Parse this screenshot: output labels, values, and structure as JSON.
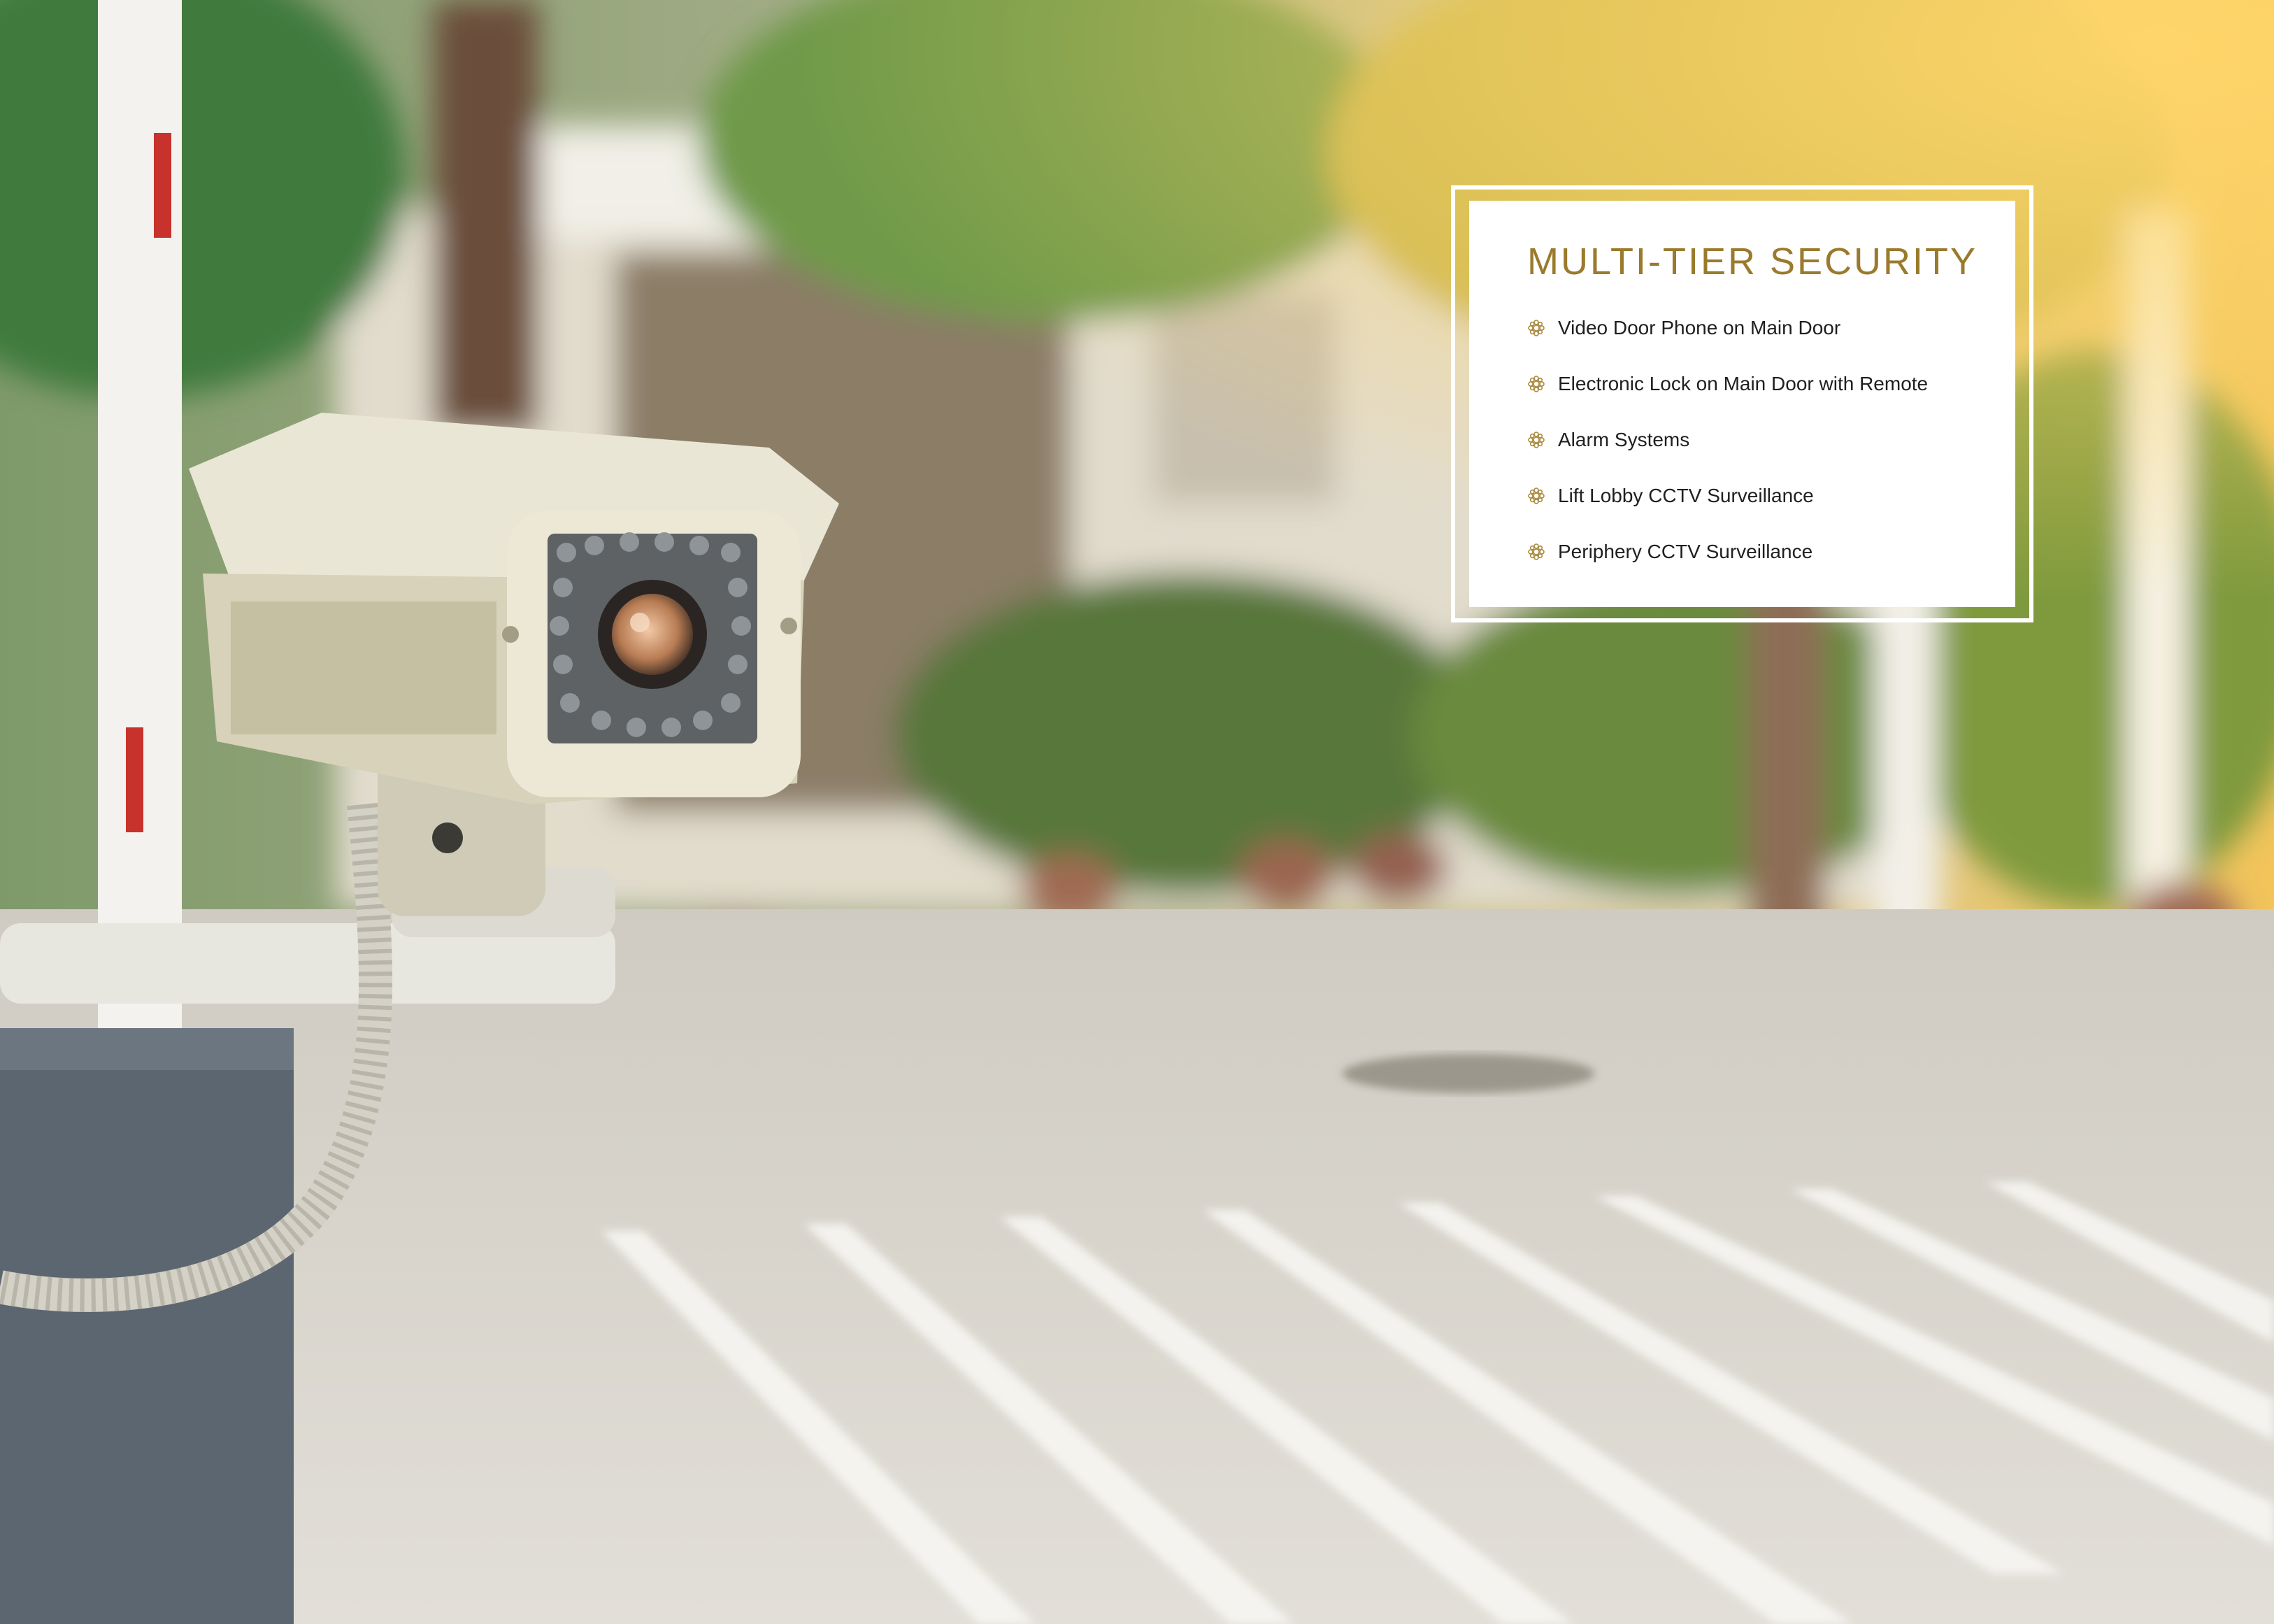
{
  "card": {
    "title": "MULTI-TIER SECURITY",
    "features": [
      "Video Door Phone on Main Door",
      "Electronic Lock on Main Door with Remote",
      "Alarm Systems",
      "Lift Lobby CCTV Surveillance",
      "Periphery CCTV Surveillance"
    ],
    "bullet_icon": "gear-flower-icon"
  },
  "colors": {
    "accent": "#9a7a2c",
    "card_bg": "#ffffff",
    "text": "#1f1f1f"
  }
}
